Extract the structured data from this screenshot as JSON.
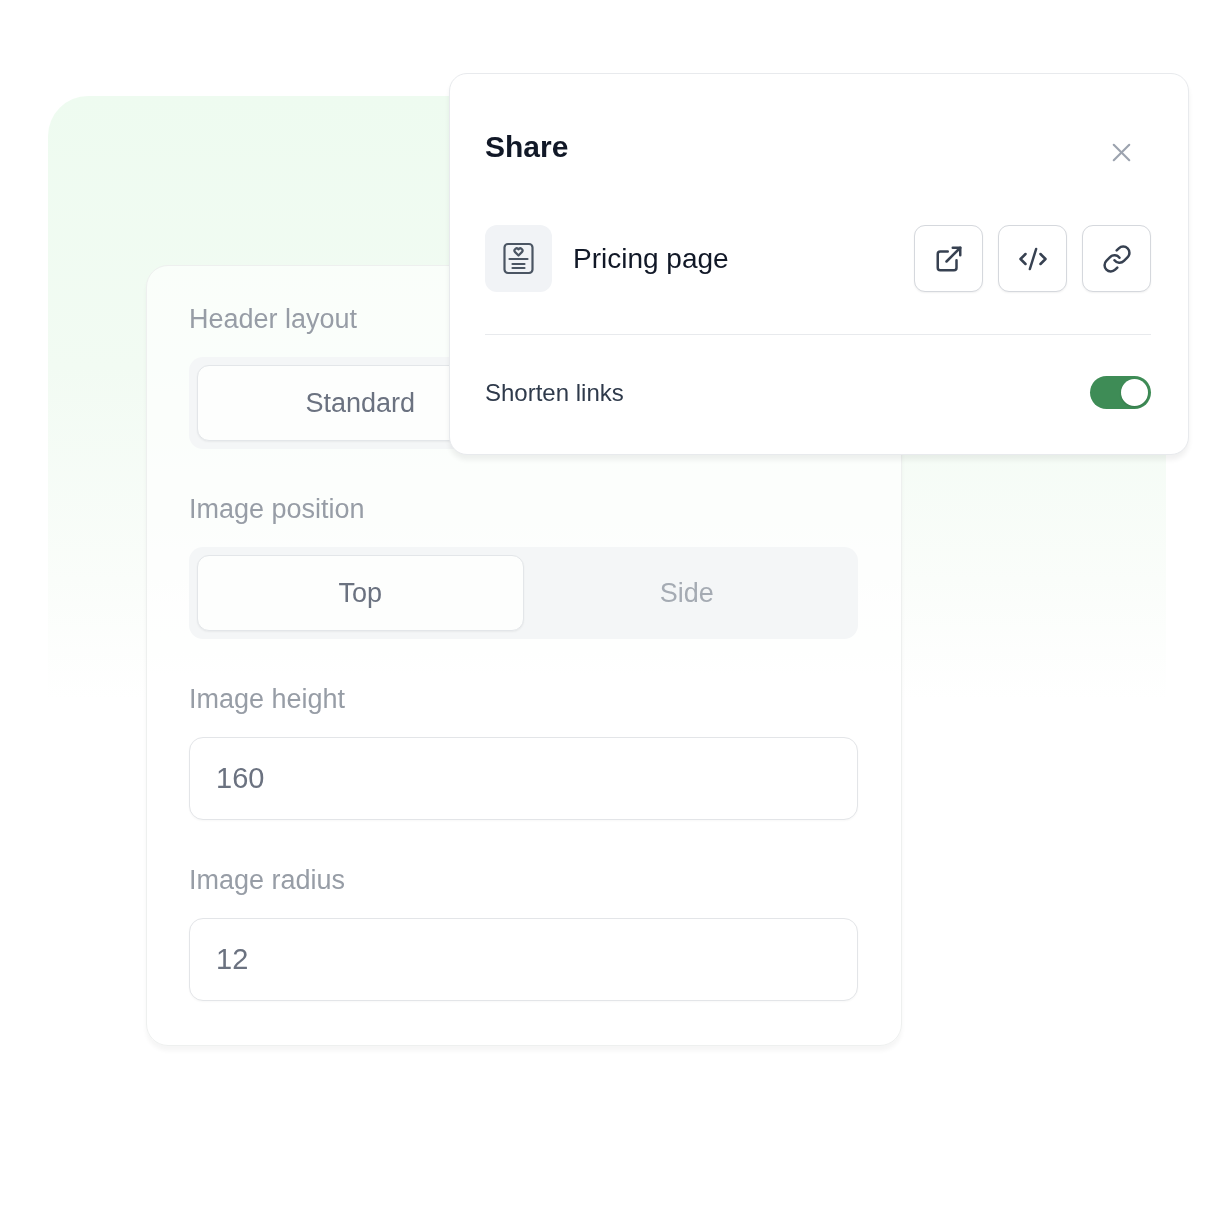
{
  "settings_card": {
    "fields": [
      {
        "kind": "segmented",
        "label": "Header layout",
        "options": [
          {
            "label": "Standard",
            "selected": true
          }
        ]
      },
      {
        "kind": "segmented",
        "label": "Image position",
        "options": [
          {
            "label": "Top",
            "selected": true
          },
          {
            "label": "Side",
            "selected": false
          }
        ]
      },
      {
        "kind": "input",
        "label": "Image height",
        "value": "160"
      },
      {
        "kind": "input",
        "label": "Image radius",
        "value": "12"
      }
    ]
  },
  "share_popup": {
    "title": "Share",
    "item": {
      "name": "Pricing page"
    },
    "actions": [
      {
        "kind": "external"
      },
      {
        "kind": "embed"
      },
      {
        "kind": "link"
      }
    ],
    "shorten_links": {
      "label": "Shorten links",
      "on": true
    }
  }
}
